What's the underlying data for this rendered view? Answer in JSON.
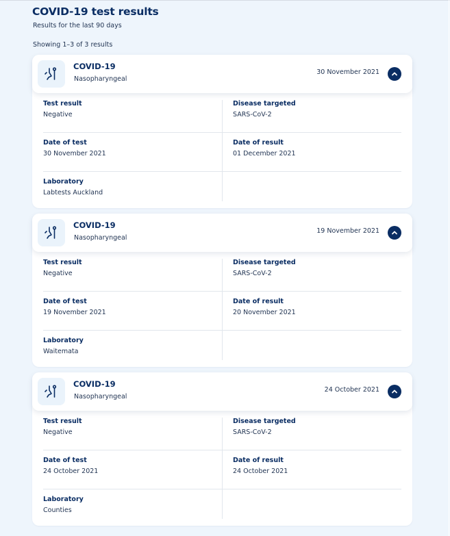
{
  "page": {
    "title": "COVID-19 test results",
    "subtitle": "Results for the last 90 days",
    "count": "Showing 1–3 of 3 results"
  },
  "labels": {
    "test_result": "Test result",
    "disease_targeted": "Disease targeted",
    "date_of_test": "Date of test",
    "date_of_result": "Date of result",
    "laboratory": "Laboratory"
  },
  "icons": {
    "test": "nasal-swab-icon",
    "toggle": "chevron-up-icon"
  },
  "colors": {
    "accent": "#0a2d63",
    "background": "#eef5fc",
    "icon_bg": "#eaf3fb"
  },
  "results": [
    {
      "title": "COVID-19",
      "sample": "Nasopharyngeal",
      "date": "30 November 2021",
      "test_result": "Negative",
      "disease_targeted": "SARS-CoV-2",
      "date_of_test": "30 November 2021",
      "date_of_result": "01 December 2021",
      "laboratory": "Labtests Auckland"
    },
    {
      "title": "COVID-19",
      "sample": "Nasopharyngeal",
      "date": "19 November 2021",
      "test_result": "Negative",
      "disease_targeted": "SARS-CoV-2",
      "date_of_test": "19 November 2021",
      "date_of_result": "20 November 2021",
      "laboratory": "Waitemata"
    },
    {
      "title": "COVID-19",
      "sample": "Nasopharyngeal",
      "date": "24 October 2021",
      "test_result": "Negative",
      "disease_targeted": "SARS-CoV-2",
      "date_of_test": "24 October 2021",
      "date_of_result": "24 October 2021",
      "laboratory": "Counties"
    }
  ]
}
